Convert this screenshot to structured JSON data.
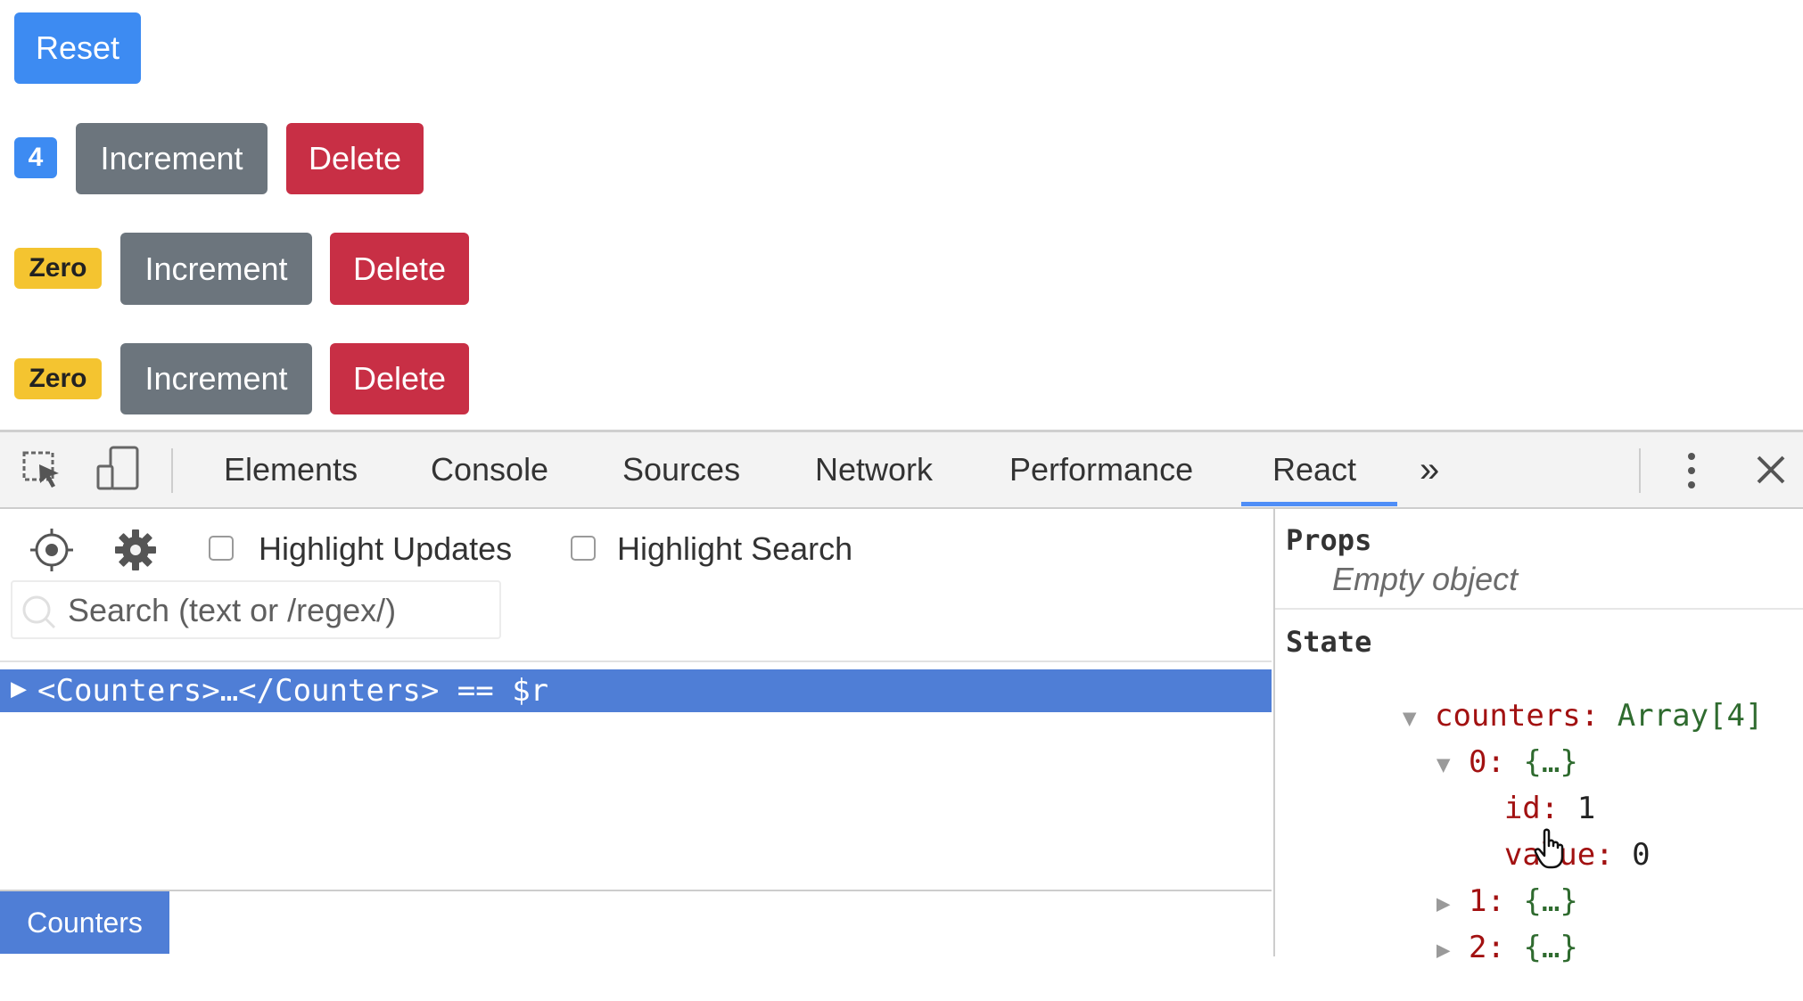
{
  "app": {
    "reset_label": "Reset",
    "counters": [
      {
        "badge": "4",
        "badge_color": "#3d8bf2",
        "increment_label": "Increment",
        "delete_label": "Delete"
      },
      {
        "badge": "Zero",
        "badge_color": "#f4c430",
        "increment_label": "Increment",
        "delete_label": "Delete"
      },
      {
        "badge": "Zero",
        "badge_color": "#f4c430",
        "increment_label": "Increment",
        "delete_label": "Delete"
      }
    ]
  },
  "devtools": {
    "tabs": [
      "Elements",
      "Console",
      "Sources",
      "Network",
      "Performance",
      "React"
    ],
    "active_tab": "React",
    "more_tabs_glyph": "»",
    "icons": [
      "inspect-element-icon",
      "device-toggle-icon",
      "kebab-menu-icon",
      "close-icon"
    ],
    "react": {
      "highlight_updates_label": "Highlight Updates",
      "highlight_search_label": "Highlight Search",
      "search_placeholder": "Search (text or /regex/)",
      "tree_row": "<Counters>…</Counters> == $r",
      "breadcrumb": "Counters",
      "props_heading": "Props",
      "props_empty": "Empty object",
      "state_heading": "State",
      "state": {
        "counters_key": "counters:",
        "counters_value": "Array[4]",
        "item0_key": "0:",
        "item0_value": "{…}",
        "id_key": "id:",
        "id_value": "1",
        "value_key": "value:",
        "value_value": "0",
        "item1_key": "1:",
        "item1_value": "{…}",
        "item2_key": "2:",
        "item2_value": "{…}"
      }
    },
    "colors": {
      "accent": "#4f8ef7",
      "selected_row": "#4f7ed6",
      "key": "#a21111",
      "string_value": "#2f6b2f"
    }
  }
}
